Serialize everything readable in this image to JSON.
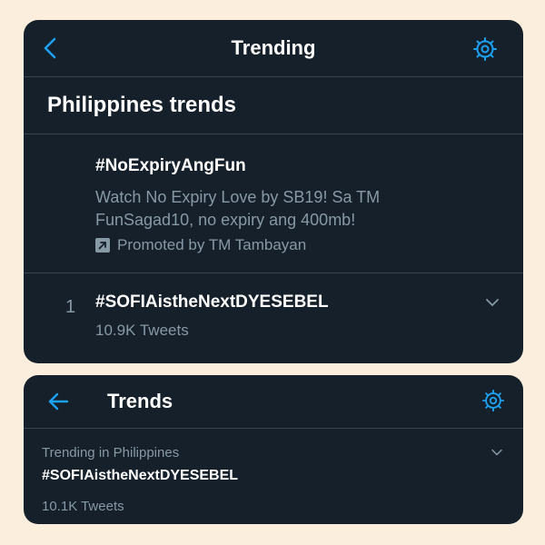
{
  "colors": {
    "background": "#fbeedd",
    "card": "#15202b",
    "divider": "#38444d",
    "accent": "#1da1f2",
    "text_primary": "#ffffff",
    "text_secondary": "#8899a6"
  },
  "trending_screen": {
    "header": {
      "title": "Trending",
      "back_icon": "chevron-left-icon",
      "settings_icon": "gear-icon"
    },
    "section_title": "Philippines trends",
    "promoted": {
      "hashtag": "#NoExpiryAngFun",
      "description": "Watch No Expiry Love by SB19! Sa TM FunSagad10, no expiry ang 400mb!",
      "promoted_label": "Promoted by TM Tambayan",
      "promoted_icon": "promoted-arrow-icon"
    },
    "trends": [
      {
        "rank": "1",
        "name": "#SOFIAistheNextDYESEBEL",
        "tweets": "10.9K Tweets"
      }
    ]
  },
  "trends_screen": {
    "header": {
      "title": "Trends",
      "back_icon": "arrow-left-icon",
      "settings_icon": "gear-icon"
    },
    "trend": {
      "context": "Trending in Philippines",
      "name": "#SOFIAistheNextDYESEBEL",
      "tweets": "10.1K Tweets"
    }
  }
}
